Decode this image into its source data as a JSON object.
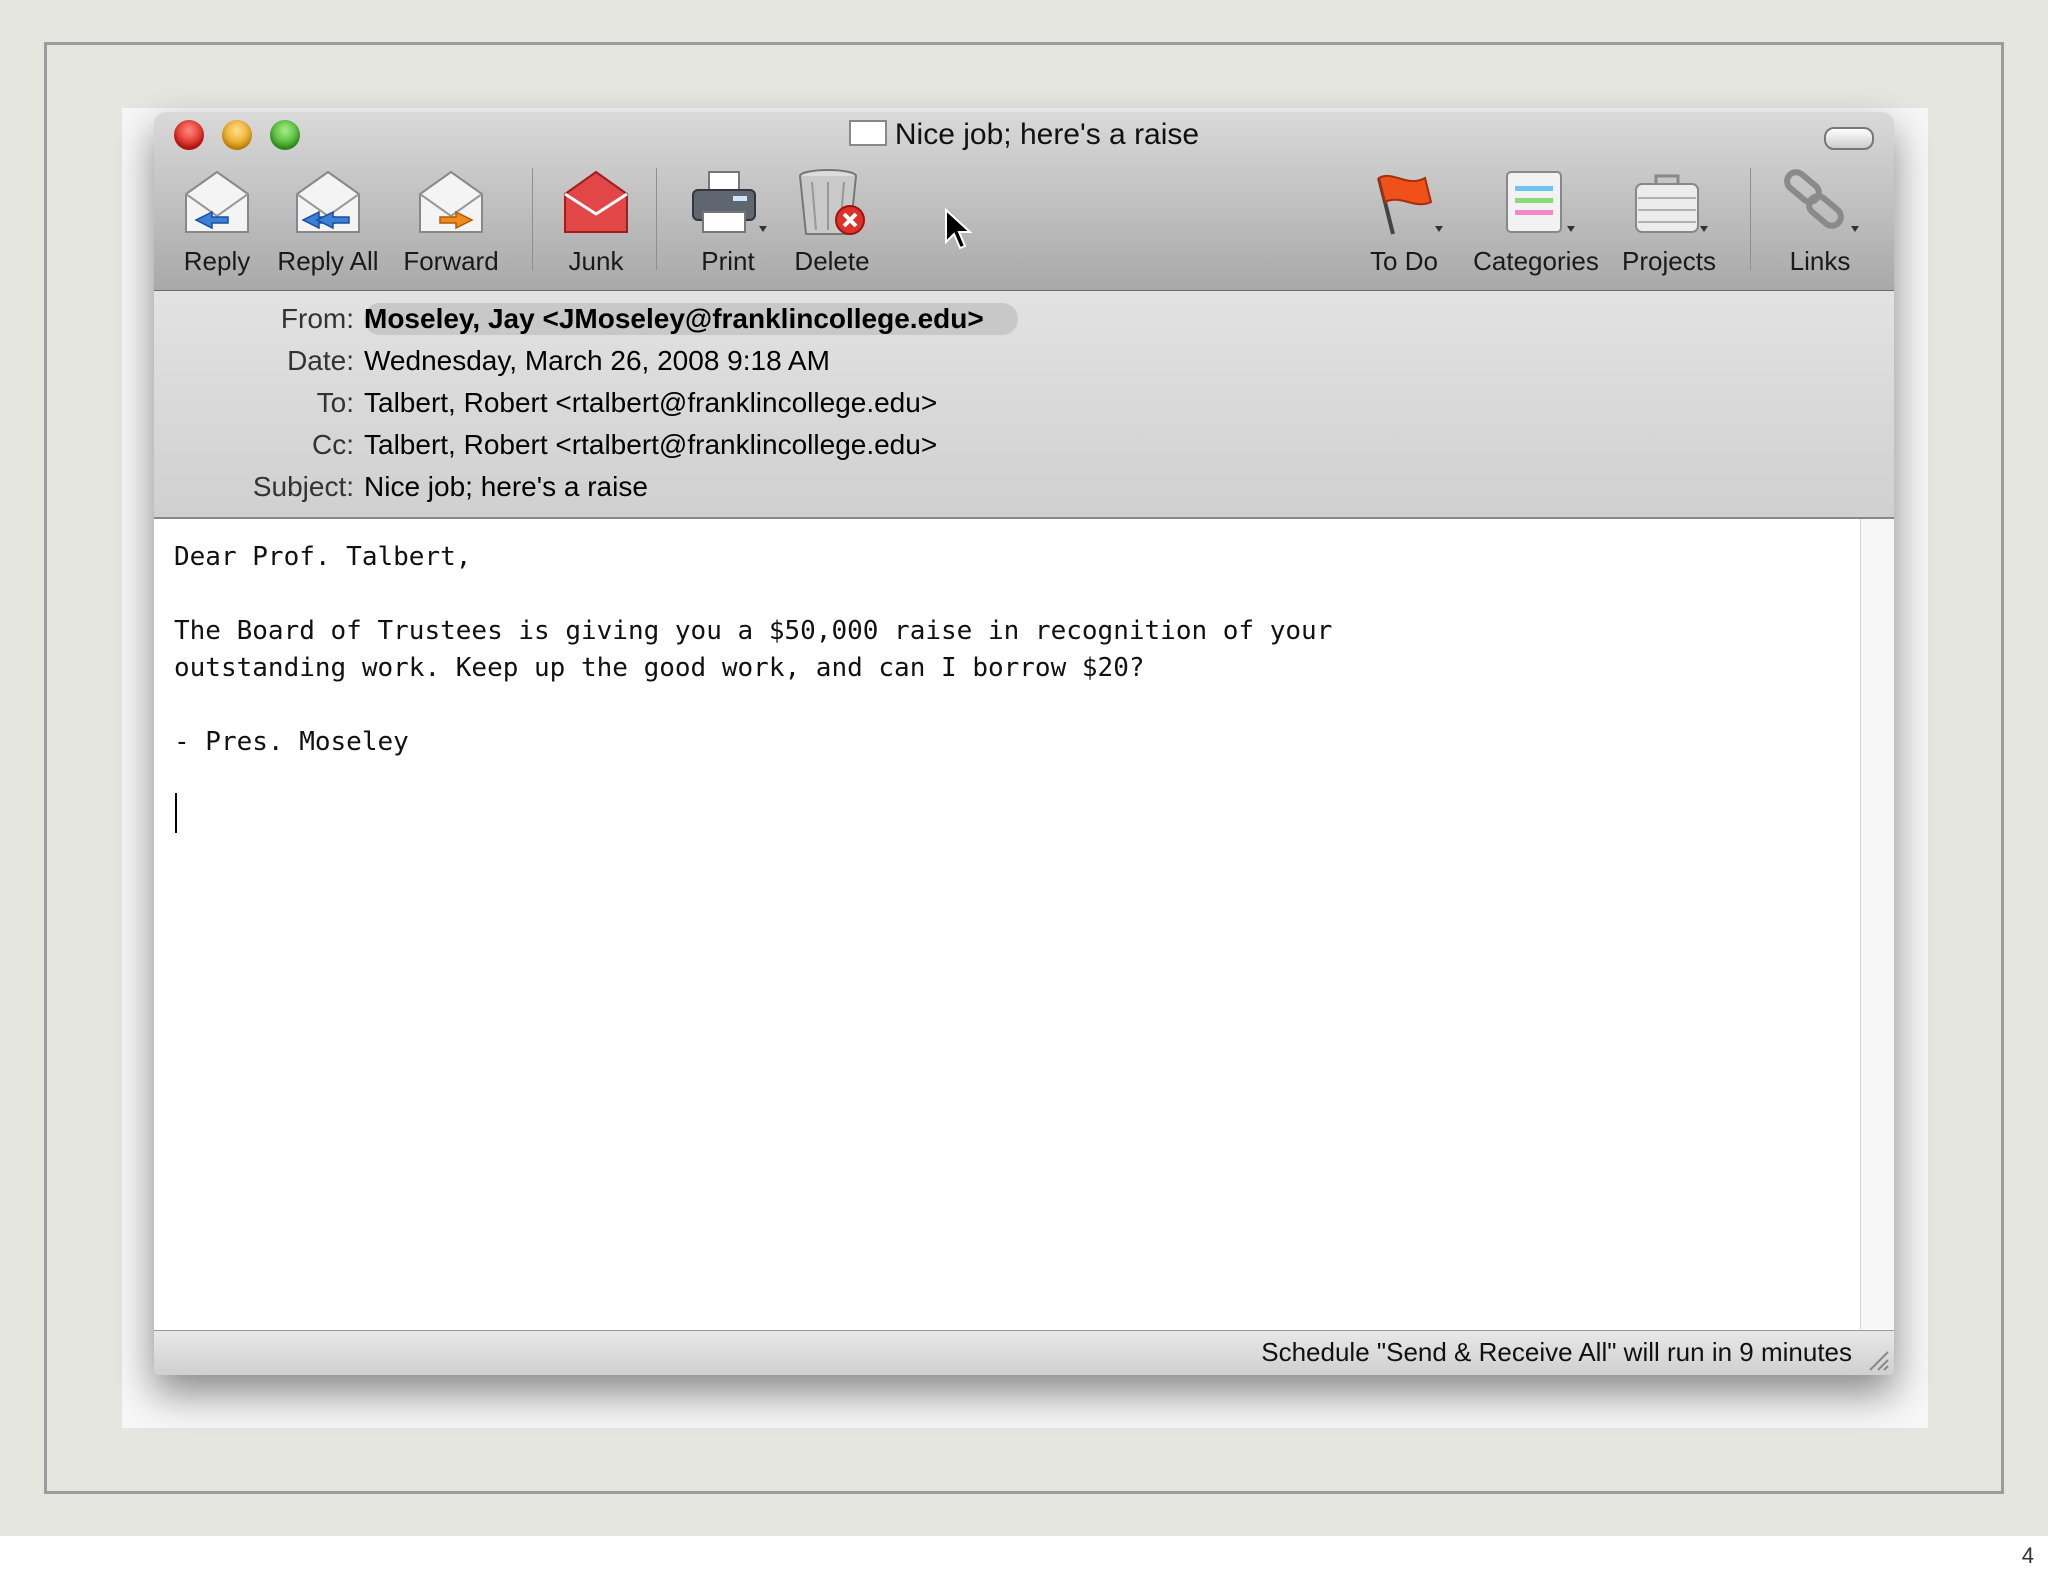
{
  "window": {
    "title": "Nice job; here's a raise"
  },
  "toolbar": {
    "reply": "Reply",
    "reply_all": "Reply All",
    "forward": "Forward",
    "junk": "Junk",
    "print": "Print",
    "delete": "Delete",
    "todo": "To Do",
    "categories": "Categories",
    "projects": "Projects",
    "links": "Links"
  },
  "headers": {
    "from_label": "From:",
    "from": "Moseley, Jay <JMoseley@franklincollege.edu>",
    "date_label": "Date:",
    "date": "Wednesday, March 26, 2008 9:18 AM",
    "to_label": "To:",
    "to": "Talbert, Robert <rtalbert@franklincollege.edu>",
    "cc_label": "Cc:",
    "cc": "Talbert, Robert <rtalbert@franklincollege.edu>",
    "subject_label": "Subject:",
    "subject": "Nice job; here's a raise"
  },
  "body": {
    "text": "Dear Prof. Talbert,\n\nThe Board of Trustees is giving you a $50,000 raise in recognition of your\noutstanding work. Keep up the good work, and can I borrow $20?\n\n- Pres. Moseley"
  },
  "status": {
    "text": "Schedule \"Send & Receive All\" will run in 9 minutes"
  },
  "slide": {
    "number": "4"
  }
}
